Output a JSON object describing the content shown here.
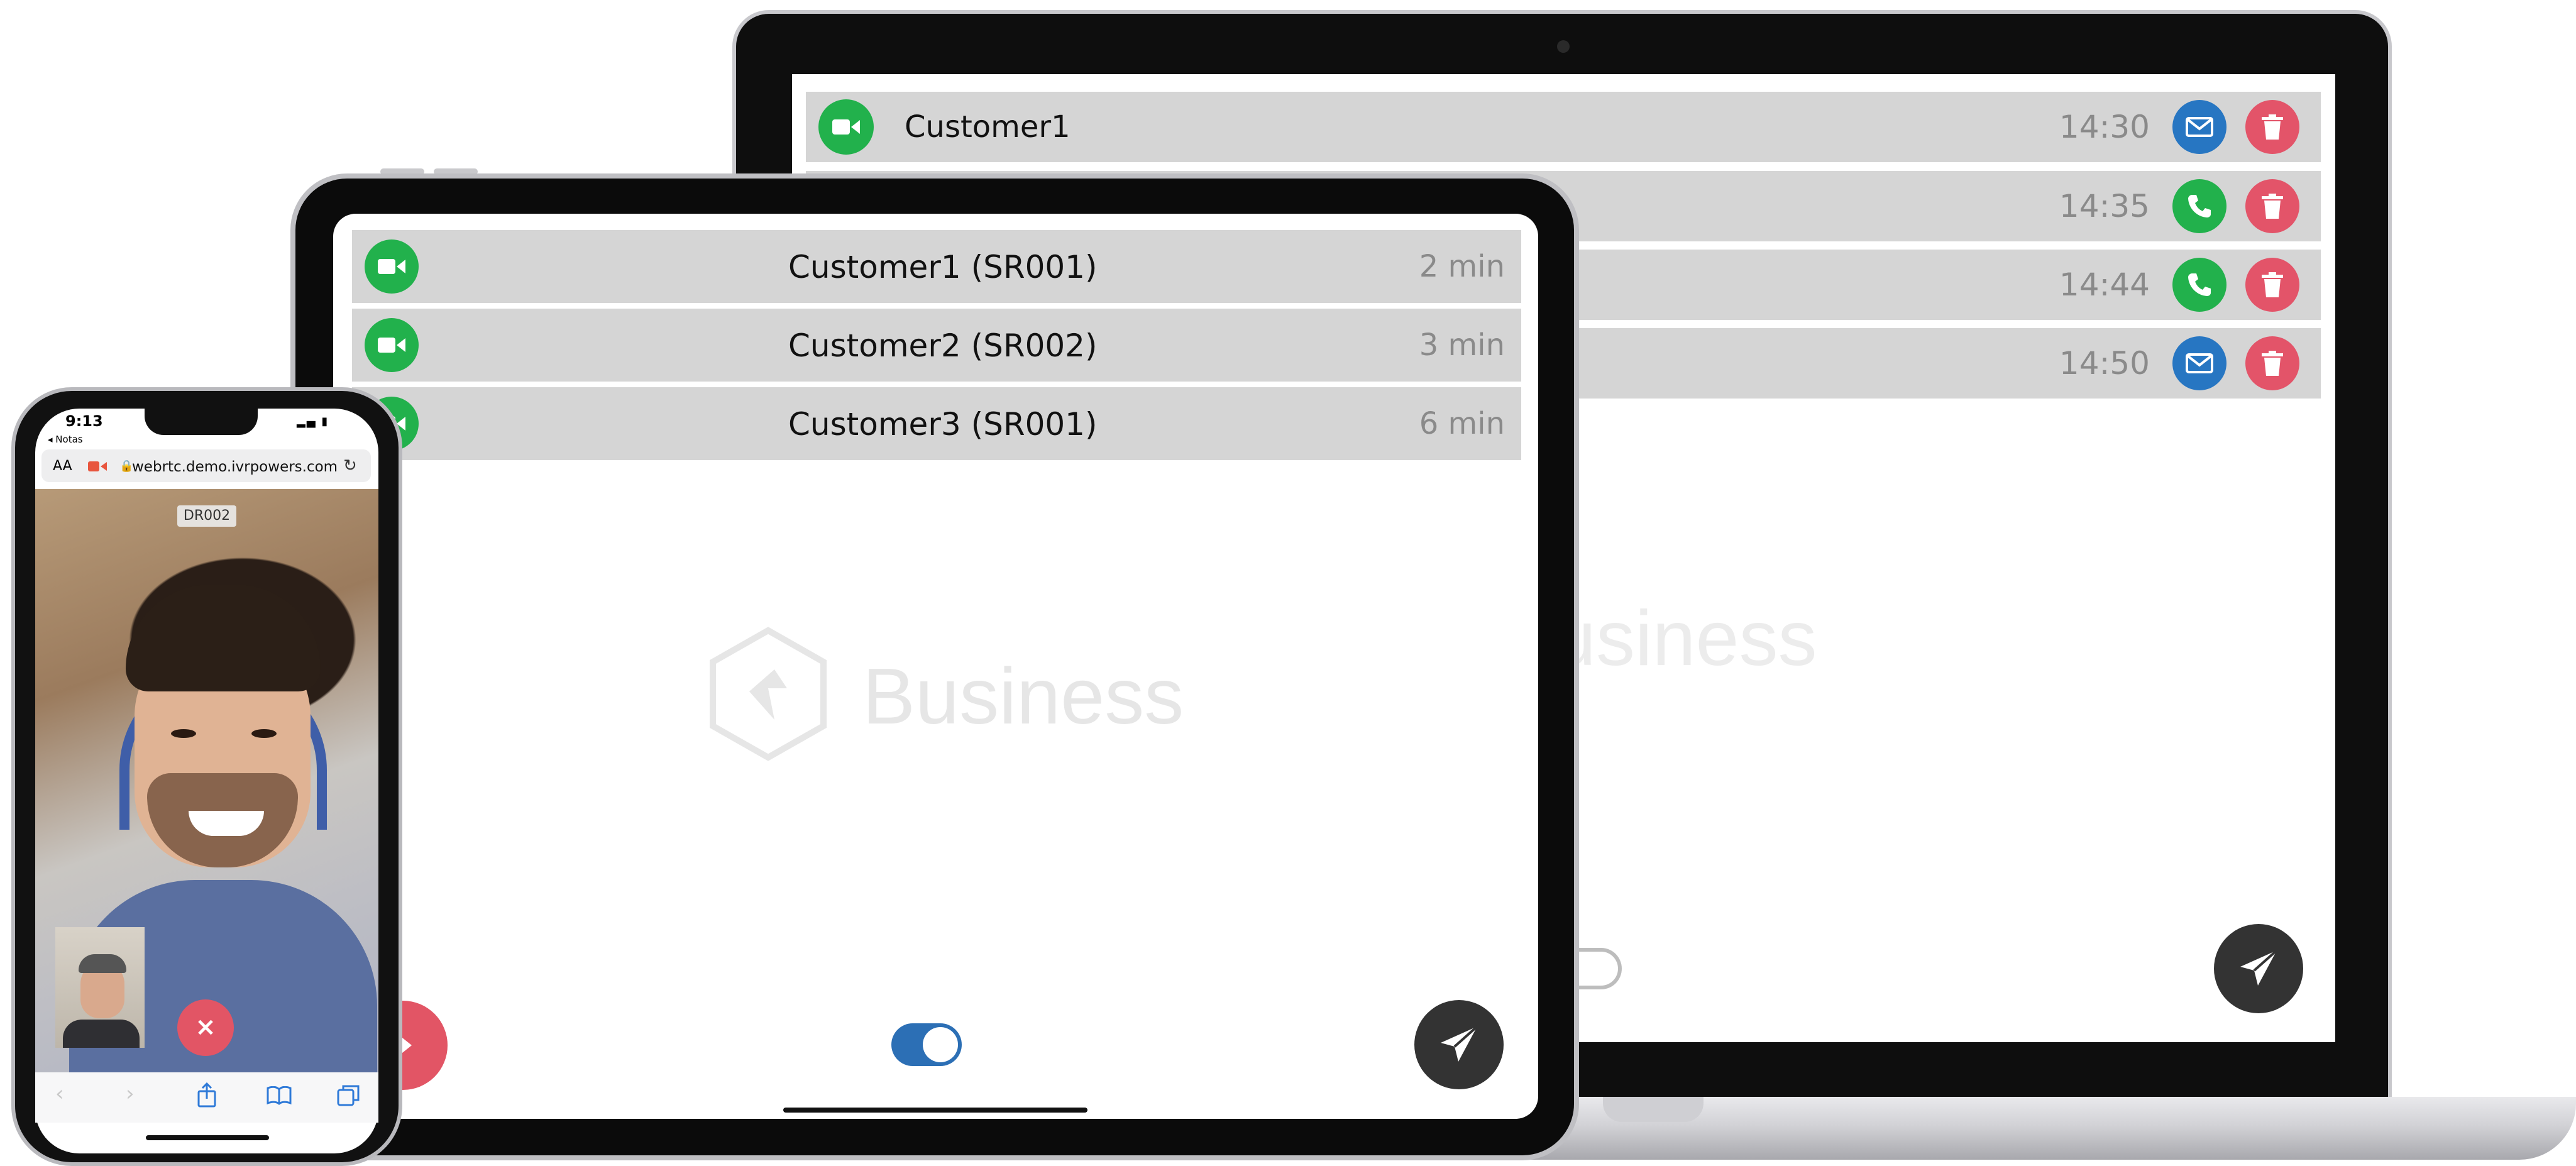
{
  "laptop": {
    "rows": [
      {
        "name": "Customer1",
        "time": "14:30",
        "action": "mail-icon"
      },
      {
        "name": "",
        "time": "14:35",
        "action": "phone-icon"
      },
      {
        "name": "",
        "time": "14:44",
        "action": "phone-icon"
      },
      {
        "name": "",
        "time": "14:50",
        "action": "mail-icon"
      }
    ],
    "watermark": "usiness"
  },
  "tablet": {
    "rows": [
      {
        "name": "Customer1 (SR001)",
        "duration": "2 min"
      },
      {
        "name": "Customer2 (SR002)",
        "duration": "3 min"
      },
      {
        "name": "Customer3 (SR001)",
        "duration": "6 min"
      }
    ],
    "watermark": "Business",
    "toggle_on": true
  },
  "phone": {
    "time": "9:13",
    "back_label": "◂ Notas",
    "text_size_label": "AA",
    "url": "webrtc.demo.ivrpowers.com",
    "video_label": "DR002"
  },
  "colors": {
    "green": "#22b14c",
    "blue": "#2776c2",
    "red": "#e35469",
    "row_bg": "#d5d5d5",
    "send_button": "#333333"
  }
}
